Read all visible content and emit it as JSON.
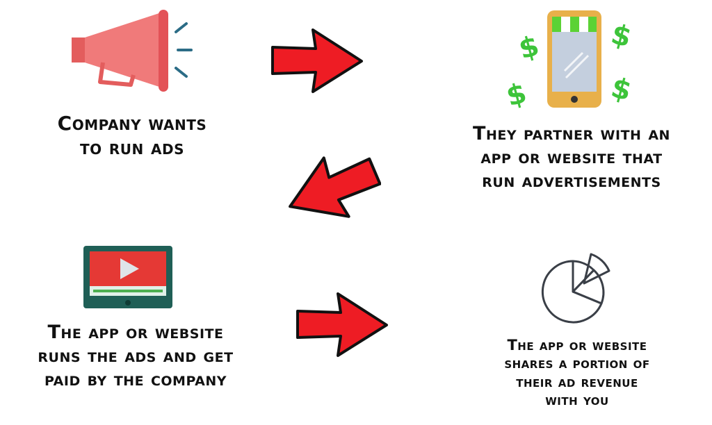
{
  "steps": [
    {
      "icon": "megaphone-icon",
      "lines": [
        "Company wants",
        "to run ads"
      ]
    },
    {
      "icon": "smartphone-store-icon",
      "lines": [
        "They partner with an",
        "app or website that",
        "run advertisements"
      ]
    },
    {
      "icon": "video-player-icon",
      "lines": [
        "The app or website",
        "runs the ads and get",
        "paid by the company"
      ]
    },
    {
      "icon": "pie-chart-icon",
      "lines": [
        "The app or website",
        "shares a portion of",
        "their ad revenue",
        "with you"
      ]
    }
  ],
  "arrows": [
    "arrow-right-icon",
    "arrow-down-left-icon",
    "arrow-right-icon"
  ],
  "colors": {
    "arrow": "#ee1c24",
    "megaphone": "#f07878",
    "phone_body": "#e8b04a",
    "phone_screen": "#c4cfde",
    "awning_green": "#5bd235",
    "dollar_green": "#3dc43a",
    "tablet": "#1f5f56",
    "video_red": "#e53935",
    "pie_stroke": "#3a3f47"
  }
}
